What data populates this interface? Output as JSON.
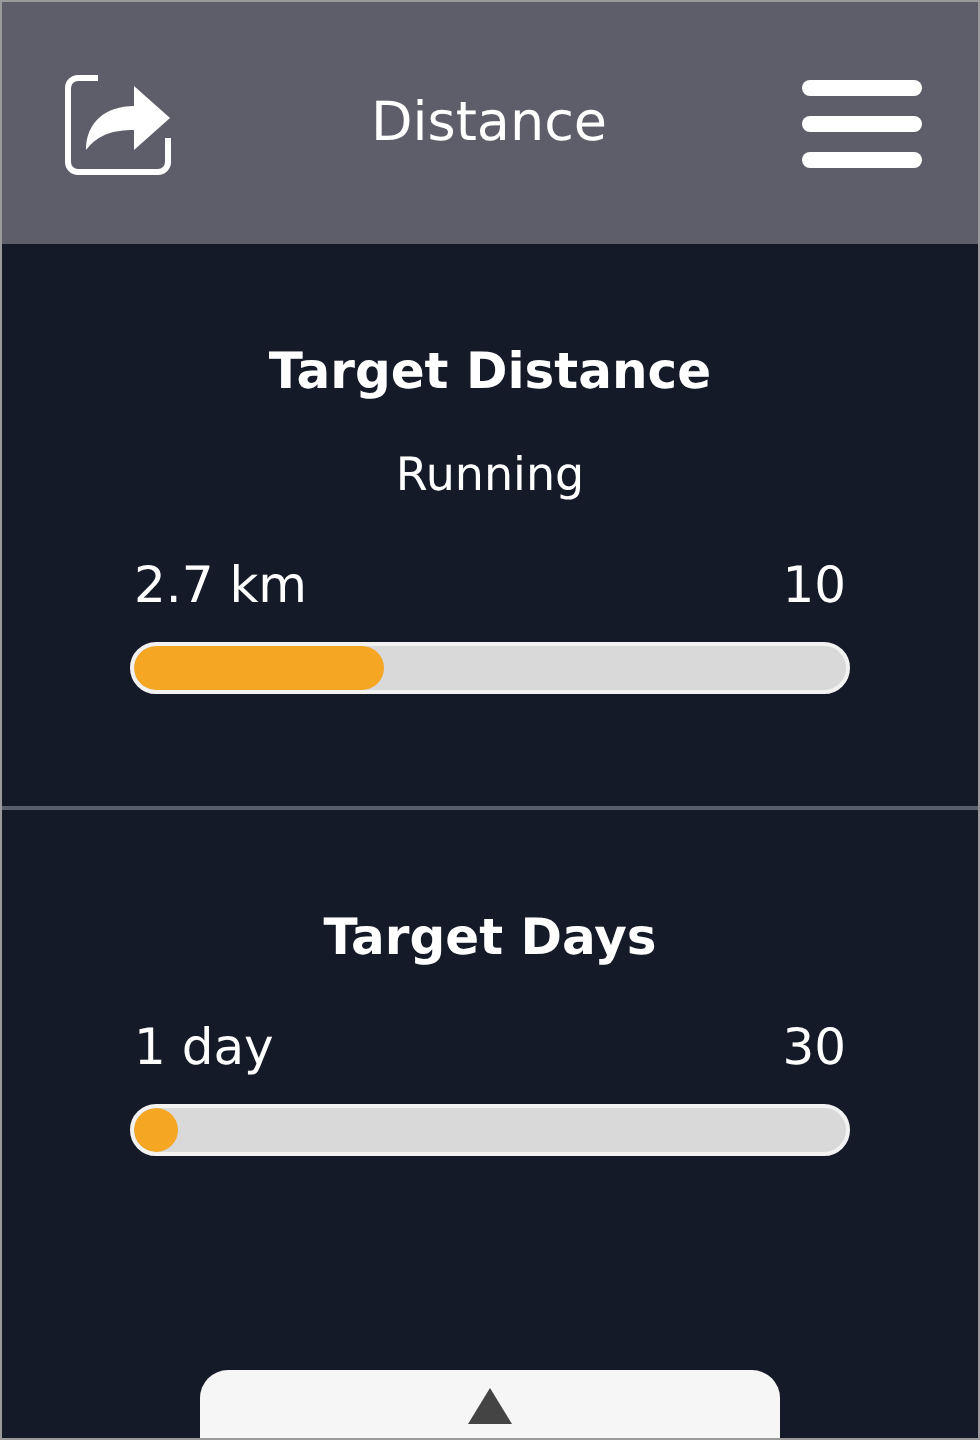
{
  "header": {
    "title": "Distance"
  },
  "sections": [
    {
      "title": "Target Distance",
      "subtitle": "Running",
      "min_label": "2.7 km",
      "max_label": "10",
      "level": 0.35
    },
    {
      "title": "Target Days",
      "min_label": "1 day",
      "max_label": "30",
      "level": 0
    }
  ]
}
